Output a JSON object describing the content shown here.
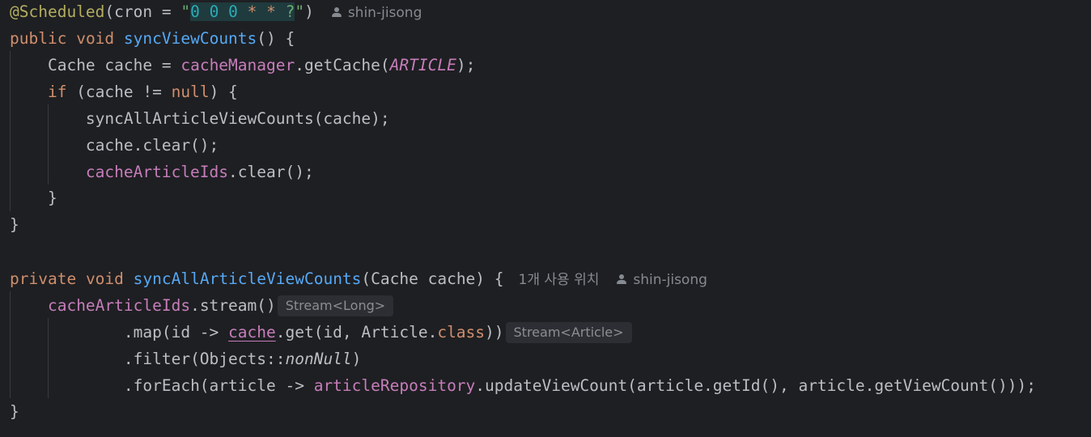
{
  "code": {
    "l1": {
      "annotation": "@Scheduled",
      "open": "(cron = ",
      "quote_open": "\"",
      "d1": "0",
      "d2": "0",
      "d3": "0",
      "s1": "*",
      "s2": "*",
      "q": "?",
      "quote_close": "\"",
      "close": ")",
      "author": "shin-jisong"
    },
    "l2": {
      "kw_public": "public",
      "kw_void": "void",
      "name": "syncViewCounts",
      "rest": "() {"
    },
    "l3": {
      "pre": "Cache cache = ",
      "field": "cacheManager",
      "mid": ".getCache(",
      "const": "ARTICLE",
      "post": ");"
    },
    "l4": {
      "kw_if": "if",
      "mid": " (cache != ",
      "kw_null": "null",
      "post": ") {"
    },
    "l5": {
      "text": "syncAllArticleViewCounts(cache);"
    },
    "l6": {
      "text": "cache.clear();"
    },
    "l7": {
      "field": "cacheArticleIds",
      "post": ".clear();"
    },
    "l8": {
      "text": "}"
    },
    "l9": {
      "text": "}"
    },
    "l11": {
      "kw_private": "private",
      "kw_void": "void",
      "name": "syncAllArticleViewCounts",
      "params": "(Cache cache) {",
      "usages": "1개 사용 위치",
      "author": "shin-jisong"
    },
    "l12": {
      "field": "cacheArticleIds",
      "post": ".stream()",
      "hint": "Stream<Long>"
    },
    "l13": {
      "pre": ".map(id -> ",
      "ref": "cache",
      "mid": ".get(id, Article.",
      "kw_class": "class",
      "post": "))",
      "hint": "Stream<Article>"
    },
    "l14": {
      "pre": ".filter(Objects::",
      "method": "nonNull",
      "post": ")"
    },
    "l15": {
      "pre": ".forEach(article -> ",
      "field": "articleRepository",
      "post": ".updateViewCount(article.getId(), article.getViewCount()));"
    },
    "l16": {
      "text": "}"
    }
  }
}
